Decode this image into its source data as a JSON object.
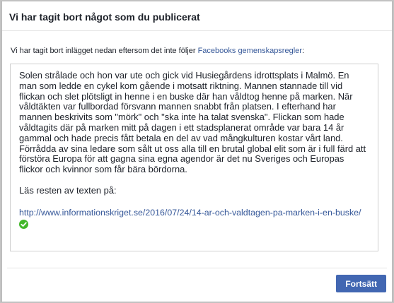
{
  "dialog": {
    "title": "Vi har tagit bort något som du publicerat",
    "intro_prefix": "Vi har tagit bort inlägget nedan eftersom det inte följer ",
    "intro_link": "Facebooks gemenskapsregler",
    "intro_suffix": ":"
  },
  "post": {
    "text": "Solen strålade och hon var ute och gick vid Husiegårdens idrottsplats i Malmö. En man som ledde en cykel kom gående i motsatt riktning. Mannen stannade till vid flickan och slet plötsligt in henne i en buske där han våldtog henne på marken. När våldtäkten var fullbordad försvann mannen snabbt från platsen. I efterhand har mannen beskrivits som \"mörk\" och \"ska inte ha talat svenska\". Flickan som hade våldtagits där på marken mitt på dagen i ett stadsplanerat område var bara 14 år gammal och hade precis fått betala en del av vad mångkulturen kostar vårt land. Förrådda av sina ledare som sålt ut oss alla till en brutal global elit som är i full färd att förstöra Europa för att gagna sina egna agendor är det nu Sveriges och Europas flickor och kvinnor som får bära bördorna.",
    "read_more": "Läs resten av texten på:",
    "link": "http://www.informationskriget.se/2016/07/24/14-ar-och-valdtagen-pa-marken-i-en-buske/"
  },
  "footer": {
    "continue_label": "Fortsätt"
  },
  "colors": {
    "link": "#365899",
    "primary_button": "#4267b2",
    "check": "#42b72a"
  },
  "icons": {
    "link_status": "green-check-circle-icon"
  }
}
